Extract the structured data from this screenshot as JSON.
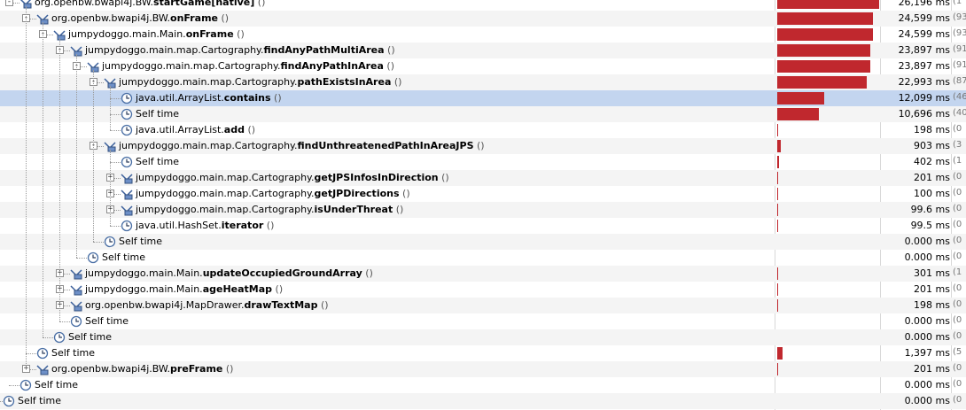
{
  "colors": {
    "bar": "#c0282e",
    "selected_row": "#c3d5ef",
    "alt_row": "#f4f4f4"
  },
  "max_time_ms": 26196,
  "rows": [
    {
      "depth": 0,
      "expander": "minus",
      "icon": "method-icon",
      "prefix": "org.openbw.bwapi4j.BW.",
      "method": "startGame[native]",
      "paren": " ()",
      "time": "26,196 ms",
      "time_ms": 26196,
      "pct": "(1"
    },
    {
      "depth": 1,
      "expander": "minus",
      "icon": "method-icon",
      "prefix": "org.openbw.bwapi4j.BW.",
      "method": "onFrame",
      "paren": " ()",
      "time": "24,599 ms",
      "time_ms": 24599,
      "pct": "(93"
    },
    {
      "depth": 2,
      "expander": "minus",
      "icon": "method-icon",
      "prefix": "jumpydoggo.main.Main.",
      "method": "onFrame",
      "paren": " ()",
      "time": "24,599 ms",
      "time_ms": 24599,
      "pct": "(93"
    },
    {
      "depth": 3,
      "expander": "minus",
      "icon": "method-icon",
      "prefix": "jumpydoggo.main.map.Cartography.",
      "method": "findAnyPathMultiArea",
      "paren": " ()",
      "time": "23,897 ms",
      "time_ms": 23897,
      "pct": "(91"
    },
    {
      "depth": 4,
      "expander": "minus",
      "icon": "method-icon",
      "prefix": "jumpydoggo.main.map.Cartography.",
      "method": "findAnyPathInArea",
      "paren": " ()",
      "time": "23,897 ms",
      "time_ms": 23897,
      "pct": "(91"
    },
    {
      "depth": 5,
      "expander": "minus",
      "icon": "method-icon",
      "prefix": "jumpydoggo.main.map.Cartography.",
      "method": "pathExistsInArea",
      "paren": " ()",
      "time": "22,993 ms",
      "time_ms": 22993,
      "pct": "(87"
    },
    {
      "depth": 6,
      "expander": "none",
      "icon": "clock-icon",
      "prefix": "java.util.ArrayList.",
      "method": "contains",
      "paren": " ()",
      "time": "12,099 ms",
      "time_ms": 12099,
      "pct": "(46",
      "selected": true
    },
    {
      "depth": 6,
      "expander": "none",
      "icon": "clock-icon",
      "prefix": "Self time",
      "method": "",
      "paren": "",
      "time": "10,696 ms",
      "time_ms": 10696,
      "pct": "(40"
    },
    {
      "depth": 6,
      "expander": "none",
      "icon": "clock-icon",
      "prefix": "java.util.ArrayList.",
      "method": "add",
      "paren": " ()",
      "time": "198 ms",
      "time_ms": 198,
      "pct": "(0"
    },
    {
      "depth": 5,
      "expander": "minus",
      "icon": "method-icon",
      "prefix": "jumpydoggo.main.map.Cartography.",
      "method": "findUnthreatenedPathInAreaJPS",
      "paren": " ()",
      "time": "903 ms",
      "time_ms": 903,
      "pct": "(3"
    },
    {
      "depth": 6,
      "expander": "none",
      "icon": "clock-icon",
      "prefix": "Self time",
      "method": "",
      "paren": "",
      "time": "402 ms",
      "time_ms": 402,
      "pct": "(1"
    },
    {
      "depth": 6,
      "expander": "plus",
      "icon": "method-icon",
      "prefix": "jumpydoggo.main.map.Cartography.",
      "method": "getJPSInfosInDirection",
      "paren": " ()",
      "time": "201 ms",
      "time_ms": 201,
      "pct": "(0"
    },
    {
      "depth": 6,
      "expander": "plus",
      "icon": "method-icon",
      "prefix": "jumpydoggo.main.map.Cartography.",
      "method": "getJPDirections",
      "paren": " ()",
      "time": "100 ms",
      "time_ms": 100,
      "pct": "(0"
    },
    {
      "depth": 6,
      "expander": "plus",
      "icon": "method-icon",
      "prefix": "jumpydoggo.main.map.Cartography.",
      "method": "isUnderThreat",
      "paren": " ()",
      "time": "99.6 ms",
      "time_ms": 99.6,
      "pct": "(0"
    },
    {
      "depth": 6,
      "expander": "none",
      "icon": "clock-icon",
      "prefix": "java.util.HashSet.",
      "method": "iterator",
      "paren": " ()",
      "time": "99.5 ms",
      "time_ms": 99.5,
      "pct": "(0"
    },
    {
      "depth": 5,
      "expander": "none",
      "icon": "clock-icon",
      "prefix": "Self time",
      "method": "",
      "paren": "",
      "time": "0.000 ms",
      "time_ms": 0,
      "pct": "(0"
    },
    {
      "depth": 4,
      "expander": "none",
      "icon": "clock-icon",
      "prefix": "Self time",
      "method": "",
      "paren": "",
      "time": "0.000 ms",
      "time_ms": 0,
      "pct": "(0"
    },
    {
      "depth": 3,
      "expander": "plus",
      "icon": "method-icon",
      "prefix": "jumpydoggo.main.Main.",
      "method": "updateOccupiedGroundArray",
      "paren": " ()",
      "time": "301 ms",
      "time_ms": 301,
      "pct": "(1"
    },
    {
      "depth": 3,
      "expander": "plus",
      "icon": "method-icon",
      "prefix": "jumpydoggo.main.Main.",
      "method": "ageHeatMap",
      "paren": " ()",
      "time": "201 ms",
      "time_ms": 201,
      "pct": "(0"
    },
    {
      "depth": 3,
      "expander": "plus",
      "icon": "method-icon",
      "prefix": "org.openbw.bwapi4j.MapDrawer.",
      "method": "drawTextMap",
      "paren": " ()",
      "time": "198 ms",
      "time_ms": 198,
      "pct": "(0"
    },
    {
      "depth": 3,
      "expander": "none",
      "icon": "clock-icon",
      "prefix": "Self time",
      "method": "",
      "paren": "",
      "time": "0.000 ms",
      "time_ms": 0,
      "pct": "(0"
    },
    {
      "depth": 2,
      "expander": "none",
      "icon": "clock-icon",
      "prefix": "Self time",
      "method": "",
      "paren": "",
      "time": "0.000 ms",
      "time_ms": 0,
      "pct": "(0"
    },
    {
      "depth": 1,
      "expander": "none",
      "icon": "clock-icon",
      "prefix": "Self time",
      "method": "",
      "paren": "",
      "time": "1,397 ms",
      "time_ms": 1397,
      "pct": "(5"
    },
    {
      "depth": 1,
      "expander": "plus",
      "icon": "method-icon",
      "prefix": "org.openbw.bwapi4j.BW.",
      "method": "preFrame",
      "paren": " ()",
      "time": "201 ms",
      "time_ms": 201,
      "pct": "(0"
    },
    {
      "depth": 0,
      "expander": "none",
      "icon": "clock-icon",
      "prefix": "Self time",
      "method": "",
      "paren": "",
      "time": "0.000 ms",
      "time_ms": 0,
      "pct": "(0"
    },
    {
      "depth": -1,
      "expander": "none",
      "icon": "clock-icon",
      "prefix": "Self time",
      "method": "",
      "paren": "",
      "time": "0.000 ms",
      "time_ms": 0,
      "pct": "(0"
    }
  ]
}
